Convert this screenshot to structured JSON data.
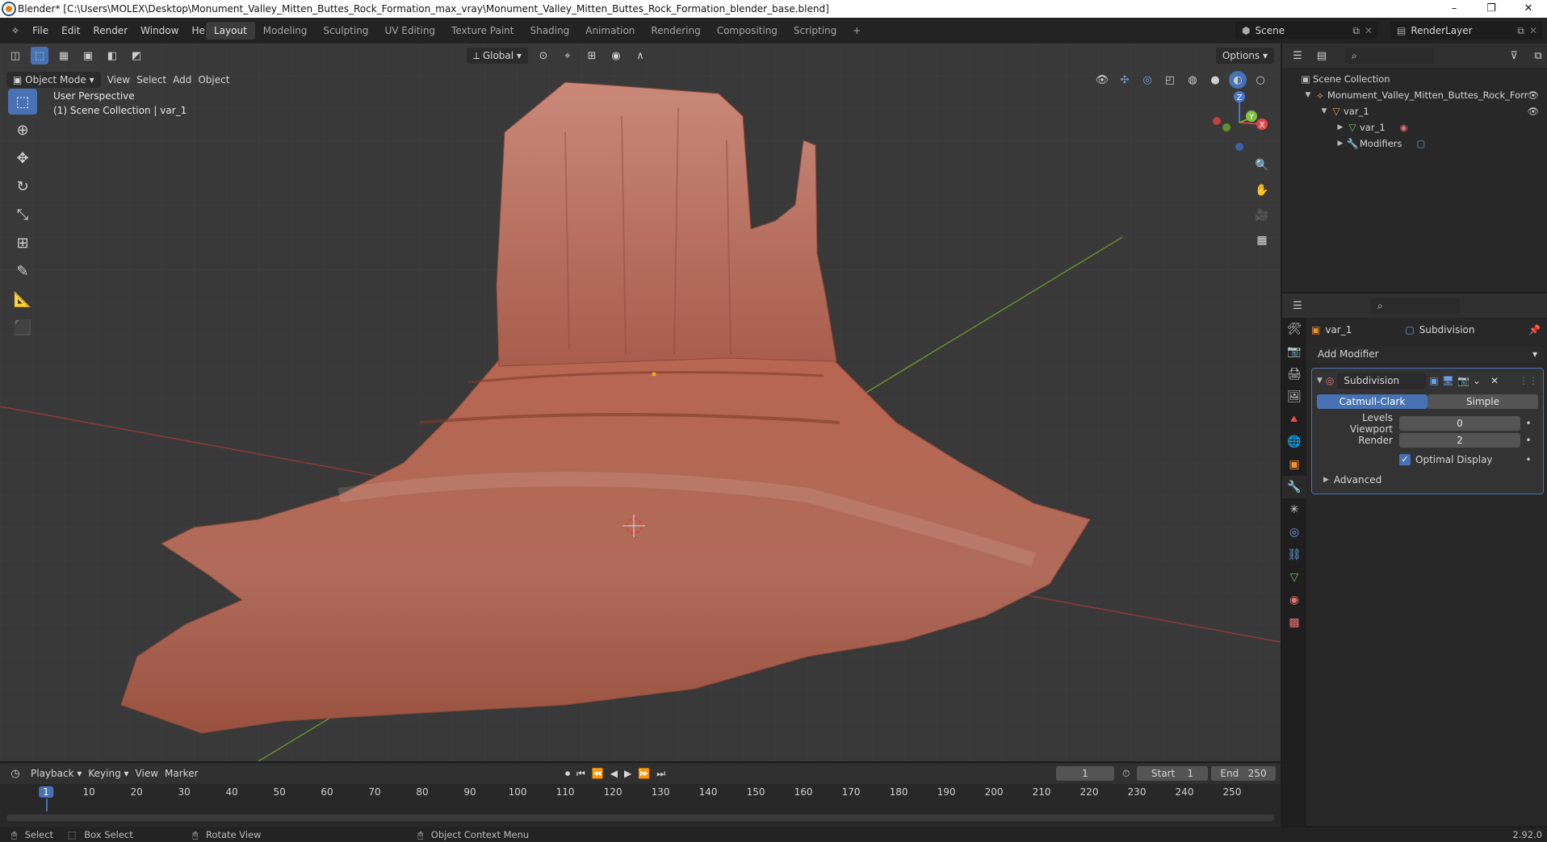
{
  "window": {
    "title": "Blender* [C:\\Users\\MOLEX\\Desktop\\Monument_Valley_Mitten_Buttes_Rock_Formation_max_vray\\Monument_Valley_Mitten_Buttes_Rock_Formation_blender_base.blend]",
    "controls": [
      "–",
      "❐",
      "✕"
    ]
  },
  "menu": [
    "File",
    "Edit",
    "Render",
    "Window",
    "Help"
  ],
  "workspaces": [
    "Layout",
    "Modeling",
    "Sculpting",
    "UV Editing",
    "Texture Paint",
    "Shading",
    "Animation",
    "Rendering",
    "Compositing",
    "Scripting",
    "+"
  ],
  "active_workspace": "Layout",
  "scene": {
    "name": "Scene",
    "render_layer": "RenderLayer"
  },
  "viewport": {
    "transform_orientation": "Global",
    "options_label": "Options",
    "mode": "Object Mode",
    "menus": [
      "View",
      "Select",
      "Add",
      "Object"
    ],
    "info_line1": "User Perspective",
    "info_line2": "(1) Scene Collection | var_1",
    "gizmo_axes": {
      "z": "Z",
      "y": "Y",
      "x": "X"
    }
  },
  "outliner": {
    "root": "Scene Collection",
    "items": [
      {
        "label": "Monument_Valley_Mitten_Buttes_Rock_Forr",
        "depth": 1
      },
      {
        "label": "var_1",
        "depth": 2
      },
      {
        "label": "var_1",
        "depth": 3
      },
      {
        "label": "Modifiers",
        "depth": 3
      }
    ]
  },
  "properties": {
    "object_name": "var_1",
    "modifier_context": "Subdivision",
    "add_modifier": "Add Modifier",
    "modifier": {
      "name": "Subdivision",
      "type_options": [
        "Catmull-Clark",
        "Simple"
      ],
      "selected_type": "Catmull-Clark",
      "levels_viewport_label": "Levels Viewport",
      "levels_viewport": "0",
      "render_label": "Render",
      "render": "2",
      "optimal_display_label": "Optimal Display",
      "optimal_display": true,
      "advanced_label": "Advanced"
    }
  },
  "timeline": {
    "menus": [
      "Playback",
      "Keying",
      "View",
      "Marker"
    ],
    "current_frame": "1",
    "start_label": "Start",
    "start": "1",
    "end_label": "End",
    "end": "250",
    "ticks": [
      "1",
      "10",
      "20",
      "30",
      "40",
      "50",
      "60",
      "70",
      "80",
      "90",
      "100",
      "110",
      "120",
      "130",
      "140",
      "150",
      "160",
      "170",
      "180",
      "190",
      "200",
      "210",
      "220",
      "230",
      "240",
      "250"
    ]
  },
  "statusbar": {
    "select": "Select",
    "box_select": "Box Select",
    "rotate_view": "Rotate View",
    "context_menu": "Object Context Menu",
    "version": "2.92.0"
  },
  "colors": {
    "accent": "#4772b3",
    "rock": "#b5685a",
    "grid_bg": "#393939"
  }
}
